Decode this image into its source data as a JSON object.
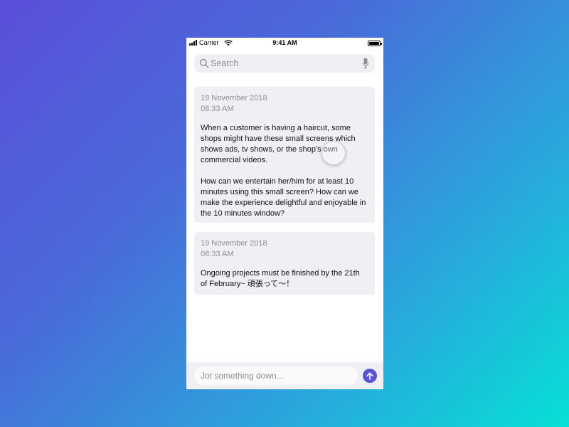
{
  "status_bar": {
    "carrier": "Carrier",
    "time": "9:41 AM"
  },
  "search": {
    "placeholder": "Search",
    "icon": "search-icon",
    "mic_icon": "mic-icon"
  },
  "notes": [
    {
      "date": "19 November 2018",
      "time": "08:33 AM",
      "body": "When a customer is having a haircut, some shops might have these small screens which shows ads, tv shows, or the shop's own commercial videos.\n\nHow can we entertain her/him for at least 10 minutes using this small screen? How can we make the experience delightful and enjoyable in the 10 minutes window?"
    },
    {
      "date": "19 November 2018",
      "time": "08:33 AM",
      "body": "Ongoing projects must be finished by the 21th of February~ 頑張って〜！"
    }
  ],
  "composer": {
    "placeholder": "Jot something down...",
    "send_icon": "arrow-up-icon"
  },
  "colors": {
    "accent": "#5b53d5",
    "card_bg": "#efeff4",
    "secondary_text": "#8e8e93"
  }
}
